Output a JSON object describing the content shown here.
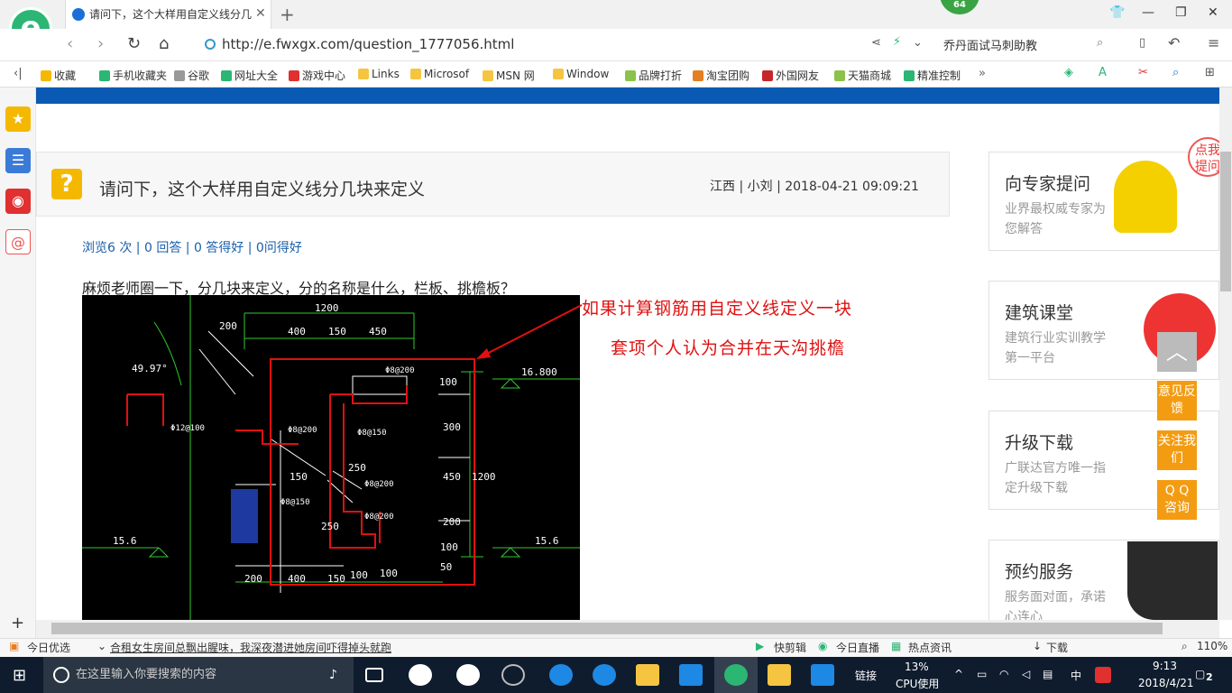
{
  "browser": {
    "tab_title": "请问下，这个大样用自定义线分几",
    "badge": "64",
    "url_host": "http://e.fwxgx.com",
    "url_path": "/question_1777056.html",
    "search_text": "乔丹面试马刺助教"
  },
  "bookmarks": [
    "收藏",
    "手机收藏夹",
    "谷歌",
    "网址大全",
    "游戏中心",
    "Links",
    "Microsof",
    "MSN 网",
    "Window",
    "品牌打折",
    "淘宝团购",
    "外国网友",
    "天猫商城",
    "精准控制"
  ],
  "question": {
    "title": "请问下，这个大样用自定义线分几块来定义",
    "meta": "江西 | 小刘 | 2018-04-21 09:09:21",
    "stats": "浏览6 次 | 0 回答 | 0 答得好 | 0问得好",
    "body": "麻烦老师圈一下，分几块来定义，分的名称是什么，栏板、挑檐板？",
    "annotation_line1": "如果计算钢筋用自定义线定义一块",
    "annotation_line2": "套项个人认为合并在天沟挑檐"
  },
  "cad": {
    "dims": [
      "200",
      "1200",
      "400",
      "150",
      "450",
      "16.800",
      "15.6",
      "15.6",
      "200",
      "400",
      "150",
      "100",
      "100",
      "100",
      "300",
      "450",
      "1200",
      "200",
      "100",
      "50",
      "150",
      "250",
      "250",
      "49.97°"
    ],
    "rebar": [
      "Φ8@200",
      "Φ8@200",
      "Φ8@150",
      "Φ8@150",
      "Φ8@200",
      "Φ8@200",
      "Φ12@100"
    ]
  },
  "sidebar_cards": [
    {
      "title": "向专家提问",
      "desc": "业界最权威专家为您解答",
      "tag": "点我提问"
    },
    {
      "title": "建筑课堂",
      "desc": "建筑行业实训教学第一平台"
    },
    {
      "title": "升级下载",
      "desc": "广联达官方唯一指定升级下载"
    },
    {
      "title": "预约服务",
      "desc": "服务面对面，承诺心连心"
    }
  ],
  "float_buttons": [
    "意见反馈",
    "关注我们",
    "Q Q 咨询"
  ],
  "statusbar": {
    "today": "今日优选",
    "news": "合租女生房间总飘出腥味，我深夜潜进她房间吓得掉头就跑",
    "items": [
      "快剪辑",
      "今日直播",
      "热点资讯",
      "下载"
    ],
    "zoom": "110%"
  },
  "taskbar": {
    "search_placeholder": "在这里输入你要搜索的内容",
    "link": "链接",
    "cpu_pct": "13%",
    "cpu_label": "CPU使用",
    "ime": "中",
    "time": "9:13",
    "date": "2018/4/21",
    "notif": "2"
  }
}
